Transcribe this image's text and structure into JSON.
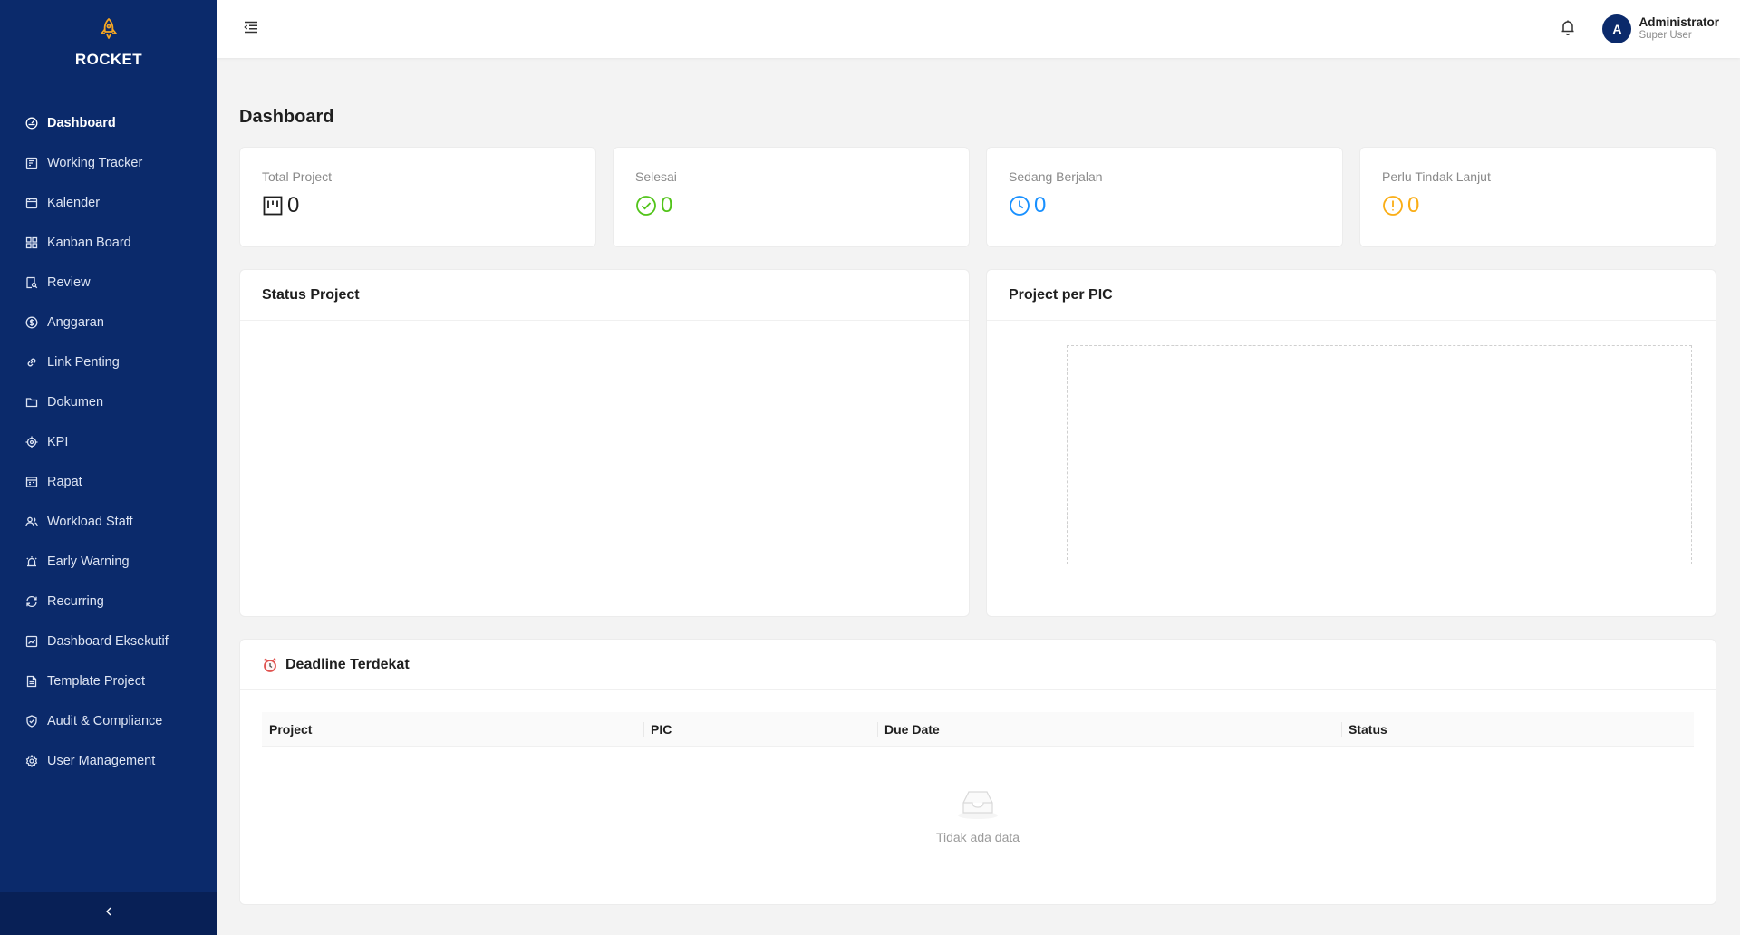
{
  "brand": {
    "name": "ROCKET"
  },
  "sidebar": {
    "items": [
      {
        "label": "Dashboard",
        "icon": "dashboard-icon",
        "active": true
      },
      {
        "label": "Working Tracker",
        "icon": "tracker-icon"
      },
      {
        "label": "Kalender",
        "icon": "calendar-icon"
      },
      {
        "label": "Kanban Board",
        "icon": "kanban-icon"
      },
      {
        "label": "Review",
        "icon": "review-icon"
      },
      {
        "label": "Anggaran",
        "icon": "budget-icon"
      },
      {
        "label": "Link Penting",
        "icon": "link-icon"
      },
      {
        "label": "Dokumen",
        "icon": "folder-icon"
      },
      {
        "label": "KPI",
        "icon": "target-icon"
      },
      {
        "label": "Rapat",
        "icon": "meeting-icon"
      },
      {
        "label": "Workload Staff",
        "icon": "team-icon"
      },
      {
        "label": "Early Warning",
        "icon": "alarm-icon"
      },
      {
        "label": "Recurring",
        "icon": "sync-icon"
      },
      {
        "label": "Dashboard Eksekutif",
        "icon": "chart-icon"
      },
      {
        "label": "Template Project",
        "icon": "file-icon"
      },
      {
        "label": "Audit & Compliance",
        "icon": "shield-check-icon"
      },
      {
        "label": "User Management",
        "icon": "gear-icon"
      }
    ]
  },
  "header": {
    "user": {
      "initial": "A",
      "name": "Administrator",
      "role": "Super User"
    }
  },
  "page": {
    "title": "Dashboard"
  },
  "stats": [
    {
      "label": "Total Project",
      "value": "0",
      "icon": "project-icon",
      "color": "#1f1f1f"
    },
    {
      "label": "Selesai",
      "value": "0",
      "icon": "check-circle-icon",
      "color": "#52c41a"
    },
    {
      "label": "Sedang Berjalan",
      "value": "0",
      "icon": "clock-icon",
      "color": "#1890ff"
    },
    {
      "label": "Perlu Tindak Lanjut",
      "value": "0",
      "icon": "exclamation-circle-icon",
      "color": "#faad14"
    }
  ],
  "panels": {
    "status_project": {
      "title": "Status Project"
    },
    "project_per_pic": {
      "title": "Project per PIC"
    },
    "deadline": {
      "title": "Deadline Terdekat",
      "columns": [
        "Project",
        "PIC",
        "Due Date",
        "Status"
      ],
      "empty_text": "Tidak ada data"
    }
  },
  "colors": {
    "sidebar_bg": "#0b2a6b",
    "accent_orange": "#f5a623"
  }
}
